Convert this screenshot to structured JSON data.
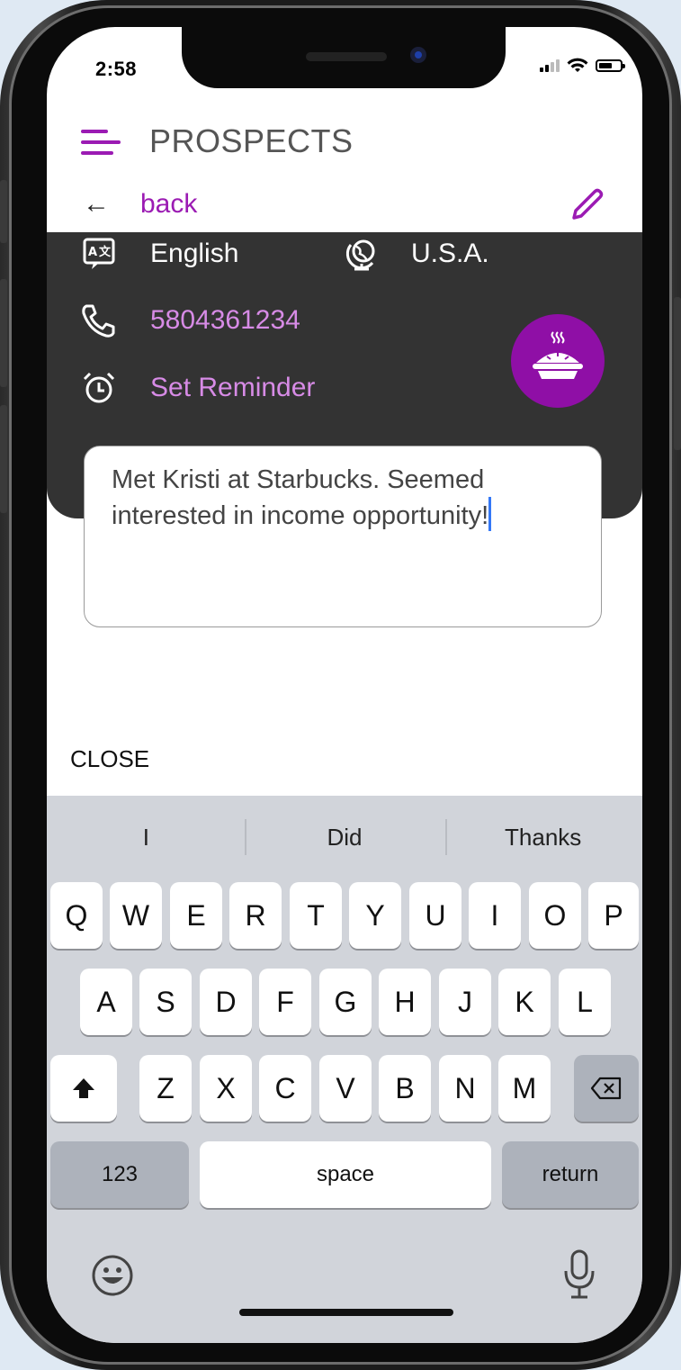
{
  "status_bar": {
    "time": "2:58"
  },
  "header": {
    "title": "PROSPECTS",
    "menu_icon": "hamburger-menu-icon"
  },
  "nav": {
    "back_label": "back",
    "back_icon": "arrow-left-icon",
    "edit_icon": "pencil-icon"
  },
  "contact": {
    "language": "English",
    "country": "U.S.A.",
    "phone": "5804361234",
    "reminder_label": "Set Reminder"
  },
  "notes": {
    "text": "Met Kristi at Starbucks. Seemed interested in income opportunity!"
  },
  "close_label": "CLOSE",
  "keyboard": {
    "suggestions": [
      "I",
      "Did",
      "Thanks"
    ],
    "row1": [
      "Q",
      "W",
      "E",
      "R",
      "T",
      "Y",
      "U",
      "I",
      "O",
      "P"
    ],
    "row2": [
      "A",
      "S",
      "D",
      "F",
      "G",
      "H",
      "J",
      "K",
      "L"
    ],
    "row3": [
      "Z",
      "X",
      "C",
      "V",
      "B",
      "N",
      "M"
    ],
    "numbers_label": "123",
    "space_label": "space",
    "return_label": "return"
  },
  "colors": {
    "accent": "#9b1bb3",
    "link": "#d78be6",
    "panel": "#333333",
    "fab": "#8f0fa6"
  }
}
